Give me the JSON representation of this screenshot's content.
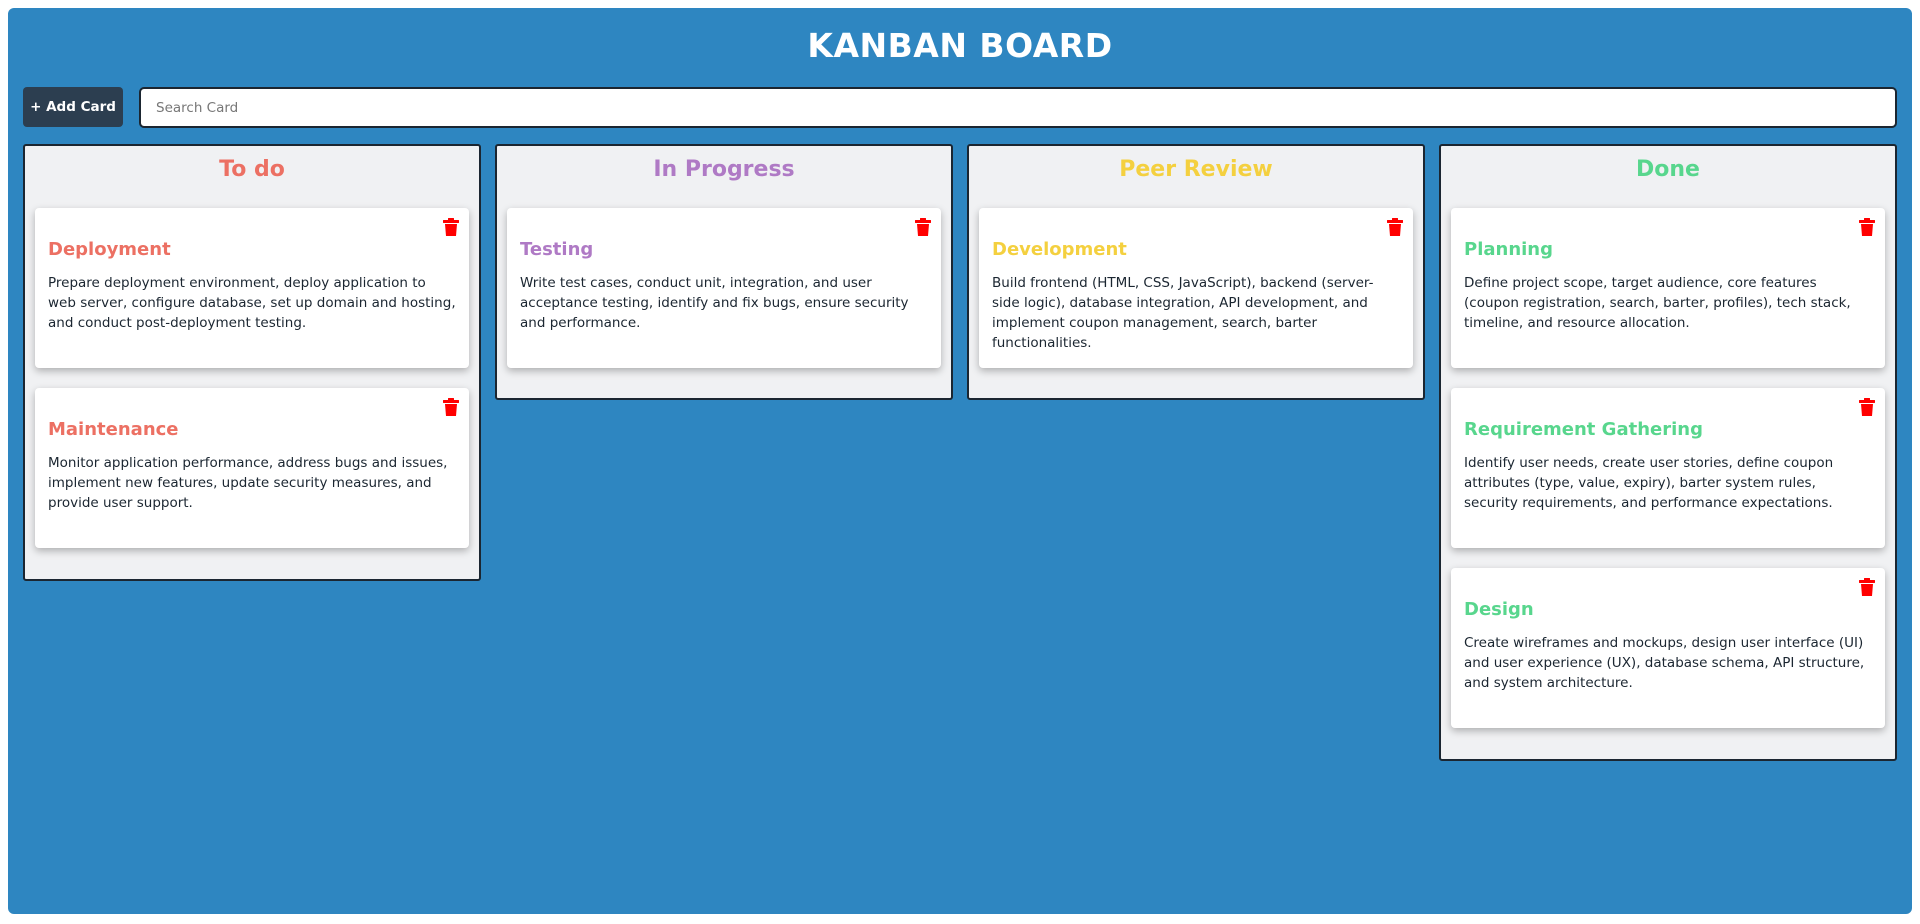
{
  "title": "KANBAN BOARD",
  "toolbar": {
    "add_label": "+ Add Card",
    "search_placeholder": "Search Card",
    "search_value": ""
  },
  "colors": {
    "background": "#2e86c1",
    "add_button": "#2c3e50",
    "delete_icon": "#ff0000"
  },
  "columns": [
    {
      "title": "To do",
      "color": "#ec7063",
      "cards": [
        {
          "title": "Deployment",
          "description": "Prepare deployment environment, deploy application to web server, configure database, set up domain and hosting, and conduct post-deployment testing."
        },
        {
          "title": "Maintenance",
          "description": "Monitor application performance, address bugs and issues, implement new features, update security measures, and provide user support."
        }
      ]
    },
    {
      "title": "In Progress",
      "color": "#af7ac5",
      "cards": [
        {
          "title": "Testing",
          "description": "Write test cases, conduct unit, integration, and user acceptance testing, identify and fix bugs, ensure security and performance."
        }
      ]
    },
    {
      "title": "Peer Review",
      "color": "#f4d03f",
      "cards": [
        {
          "title": "Development",
          "description": "Build frontend (HTML, CSS, JavaScript), backend (server-side logic), database integration, API development, and implement coupon management, search, barter functionalities."
        }
      ]
    },
    {
      "title": "Done",
      "color": "#58d68d",
      "cards": [
        {
          "title": "Planning",
          "description": "Define project scope, target audience, core features (coupon registration, search, barter, profiles), tech stack, timeline, and resource allocation."
        },
        {
          "title": "Requirement Gathering",
          "description": "Identify user needs, create user stories, define coupon attributes (type, value, expiry), barter system rules, security requirements, and performance expectations."
        },
        {
          "title": "Design",
          "description": "Create wireframes and mockups, design user interface (UI) and user experience (UX), database schema, API structure, and system architecture."
        }
      ]
    }
  ]
}
